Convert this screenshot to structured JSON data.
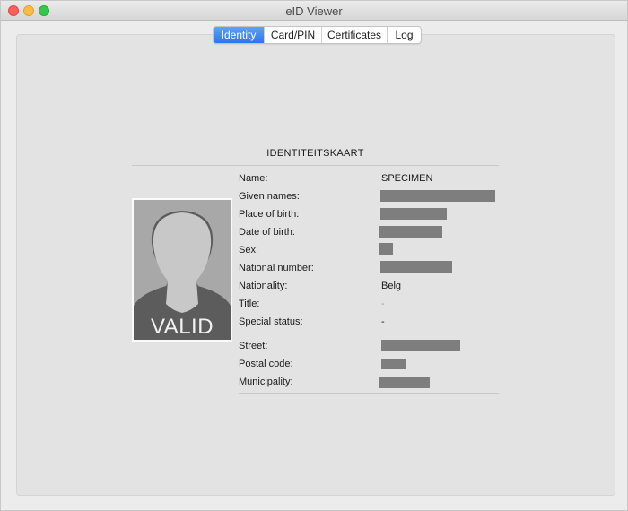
{
  "window": {
    "title": "eID Viewer"
  },
  "tabs": [
    "Identity",
    "Card/PIN",
    "Certificates",
    "Log"
  ],
  "card": {
    "heading": "IDENTITEITSKAART",
    "photo_badge": "VALID"
  },
  "fields": {
    "name": {
      "label": "Name:",
      "value": "SPECIMEN"
    },
    "given_names": {
      "label": "Given names:"
    },
    "place_of_birth": {
      "label": "Place of birth:"
    },
    "date_of_birth": {
      "label": "Date of birth:"
    },
    "sex": {
      "label": "Sex:"
    },
    "national_number": {
      "label": "National number:"
    },
    "nationality": {
      "label": "Nationality:",
      "value": "Belg"
    },
    "title": {
      "label": "Title:",
      "value": "-"
    },
    "special_status": {
      "label": "Special status:",
      "value": "-"
    },
    "street": {
      "label": "Street:"
    },
    "postal_code": {
      "label": "Postal code:"
    },
    "municipality": {
      "label": "Municipality:"
    }
  },
  "colors": {
    "tab_active": "#2b76ed",
    "redaction": "#7e7e7e"
  }
}
